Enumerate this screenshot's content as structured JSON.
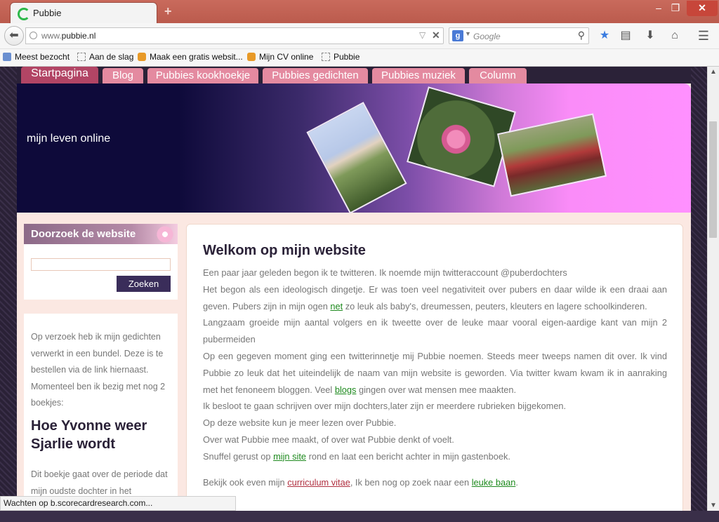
{
  "browser": {
    "tab_title": "Pubbie",
    "new_tab": "+",
    "url_prefix": "www.",
    "url_domain": "pubbie.nl",
    "search_engine_icon": "g",
    "search_placeholder": "Google",
    "window_controls": {
      "minimize": "–",
      "maximize": "❐",
      "close": "✕"
    },
    "bookmarks": [
      "Meest bezocht",
      "Aan de slag",
      "Maak een gratis websit...",
      "Mijn CV online",
      "Pubbie"
    ],
    "status": "Wachten op b.scorecardresearch.com..."
  },
  "site": {
    "menu": [
      "Startpagina",
      "Blog",
      "Pubbies kookhoekje",
      "Pubbies gedichten",
      "Pubbies muziek",
      "Column"
    ],
    "tagline": "mijn leven online",
    "sidebar": {
      "search_title": "Doorzoek de website",
      "search_button": "Zoeken",
      "promo_text": "Op verzoek heb ik mijn gedichten verwerkt in een bundel. Deze is te bestellen via de link hiernaast. Momenteel ben ik bezig met nog 2 boekjes:",
      "promo_title": "Hoe Yvonne weer Sjarlie wordt",
      "promo_text2": "Dit boekje gaat over de periode dat mijn oudste dochter in het"
    },
    "content": {
      "heading": "Welkom op mijn website",
      "p1": "Een paar jaar geleden begon ik te twitteren. Ik noemde mijn twitteraccount @puberdochters",
      "p2_a": "Het begon als een ideologisch dingetje. Er was toen veel negativiteit over pubers en daar wilde ik een draai aan geven. Pubers zijn in mijn ogen ",
      "p2_link": "net",
      "p2_b": " zo leuk als baby's, dreumessen, peuters, kleuters en lagere schoolkinderen.",
      "p3": "Langzaam groeide mijn aantal volgers en ik tweette over de leuke maar vooral eigen-aardige kant van mijn 2 pubermeiden",
      "p4_a": "Op een gegeven moment ging een twitterinnetje mij Pubbie noemen. Steeds meer tweeps namen dit over. Ik vind Pubbie zo leuk dat het uiteindelijk de naam van mijn website is geworden. Via twitter kwam kwam ik in aanraking met het fenoneem bloggen. Veel ",
      "p4_link": "blogs",
      "p4_b": " gingen over wat mensen mee maakten.",
      "p5": "Ik besloot te gaan schrijven over mijn dochters,later zijn er meerdere rubrieken bijgekomen.",
      "p6": "Op deze website kun je meer lezen over Pubbie.",
      "p7": "Over wat Pubbie mee maakt, of over wat Pubbie denkt of voelt.",
      "p8_a": "Snuffel gerust op ",
      "p8_link": "mijn site",
      "p8_b": " rond en laat een bericht achter in mijn gastenboek.",
      "p9_a": "Bekijk ook even mijn ",
      "p9_link1": "curriculum vitae",
      "p9_b": ", Ik ben nog op zoek naar een ",
      "p9_link2": "leuke baan",
      "p9_c": "."
    }
  },
  "colors": {
    "menu_tab": "#e48aa0",
    "menu_active": "#b24565",
    "link_green": "#1e8a1e",
    "link_red": "#b03040",
    "header_dark": "#0e0a3a",
    "header_pink": "#ff90ff"
  }
}
